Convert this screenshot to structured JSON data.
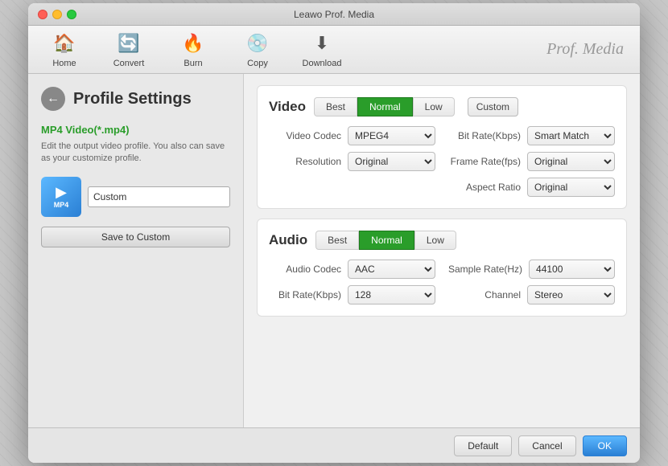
{
  "titlebar": {
    "title": "Leawo Prof. Media"
  },
  "toolbar": {
    "items": [
      {
        "id": "home",
        "label": "Home",
        "icon": "🏠"
      },
      {
        "id": "convert",
        "label": "Convert",
        "icon": "🔄"
      },
      {
        "id": "burn",
        "label": "Burn",
        "icon": "🔥"
      },
      {
        "id": "copy",
        "label": "Copy",
        "icon": "💿"
      },
      {
        "id": "download",
        "label": "Download",
        "icon": "⬇"
      }
    ],
    "brand": "Prof. Media"
  },
  "sidebar": {
    "back_button": "←",
    "title": "Profile Settings",
    "subtitle": "MP4 Video(*.mp4)",
    "description": "Edit the output video profile. You also can save as your customize profile.",
    "file_icon_label": "MP4",
    "file_name": "Custom",
    "save_button": "Save to Custom"
  },
  "video": {
    "section_title": "Video",
    "buttons": [
      "Best",
      "Normal",
      "Low"
    ],
    "active_button": "Normal",
    "custom_button": "Custom",
    "codec_label": "Video Codec",
    "codec_value": "MPEG4",
    "resolution_label": "Resolution",
    "resolution_value": "Original",
    "bitrate_label": "Bit Rate(Kbps)",
    "bitrate_value": "Smart Match",
    "framerate_label": "Frame Rate(fps)",
    "framerate_value": "Original",
    "aspect_label": "Aspect Ratio",
    "aspect_value": "Original"
  },
  "audio": {
    "section_title": "Audio",
    "buttons": [
      "Best",
      "Normal",
      "Low"
    ],
    "active_button": "Normal",
    "codec_label": "Audio Codec",
    "codec_value": "AAC",
    "bitrate_label": "Bit Rate(Kbps)",
    "bitrate_value": "128",
    "samplerate_label": "Sample Rate(Hz)",
    "samplerate_value": "44100",
    "channel_label": "Channel",
    "channel_value": "Stereo"
  },
  "bottom": {
    "default_label": "Default",
    "cancel_label": "Cancel",
    "ok_label": "OK"
  }
}
